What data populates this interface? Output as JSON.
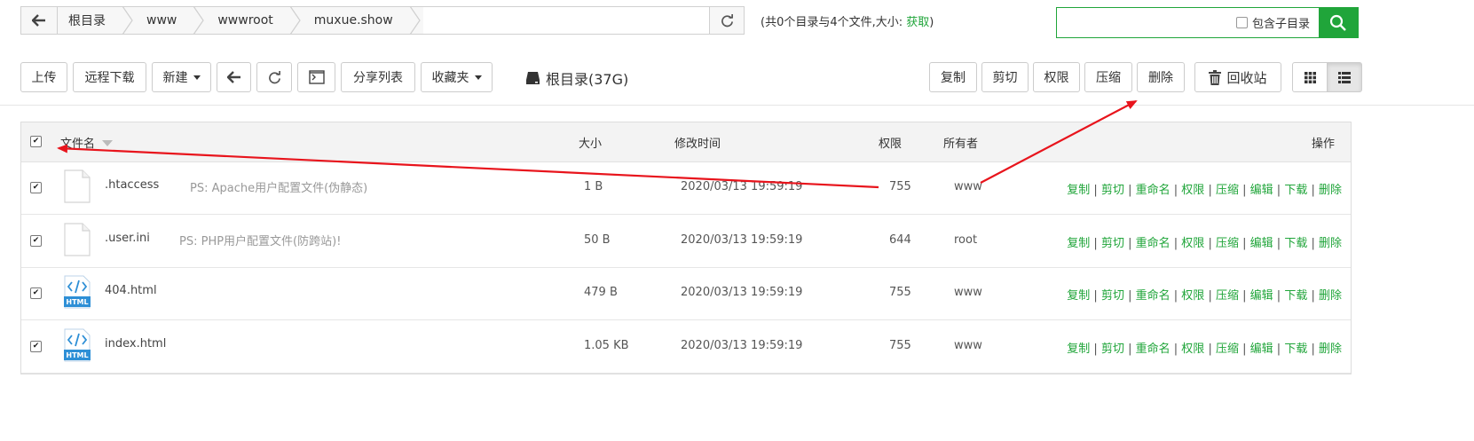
{
  "breadcrumb": {
    "items": [
      "根目录",
      "www",
      "wwwroot",
      "muxue.show"
    ]
  },
  "summary": {
    "text": "(共0个目录与4个文件,大小: ",
    "link": "获取",
    "close": ")"
  },
  "search": {
    "placeholder": "",
    "include_sub_label": "包含子目录"
  },
  "toolbar": {
    "upload": "上传",
    "remote_download": "远程下载",
    "new": "新建",
    "share_list": "分享列表",
    "favorites": "收藏夹",
    "disk": "根目录(37G)",
    "copy": "复制",
    "cut": "剪切",
    "permission": "权限",
    "compress": "压缩",
    "delete": "删除",
    "recycle": "回收站"
  },
  "table": {
    "headers": {
      "name": "文件名",
      "size": "大小",
      "mtime": "修改时间",
      "perm": "权限",
      "owner": "所有者",
      "ops": "操作"
    },
    "rows": [
      {
        "name": ".htaccess",
        "ps": "PS: Apache用户配置文件(伪静态)",
        "size": "1 B",
        "mtime": "2020/03/13 19:59:19",
        "perm": "755",
        "owner": "www",
        "icon": "file-icon"
      },
      {
        "name": ".user.ini",
        "ps": "PS: PHP用户配置文件(防跨站)!",
        "size": "50 B",
        "mtime": "2020/03/13 19:59:19",
        "perm": "644",
        "owner": "root",
        "icon": "file-icon"
      },
      {
        "name": "404.html",
        "ps": "",
        "size": "479 B",
        "mtime": "2020/03/13 19:59:19",
        "perm": "755",
        "owner": "www",
        "icon": "html-file-icon"
      },
      {
        "name": "index.html",
        "ps": "",
        "size": "1.05 KB",
        "mtime": "2020/03/13 19:59:19",
        "perm": "755",
        "owner": "www",
        "icon": "html-file-icon"
      }
    ],
    "row_ops": [
      "复制",
      "剪切",
      "重命名",
      "权限",
      "压缩",
      "编辑",
      "下载",
      "删除"
    ],
    "html_badge": "HTML"
  },
  "colors": {
    "accent": "#20a53a",
    "arrow": "#e8141c"
  }
}
